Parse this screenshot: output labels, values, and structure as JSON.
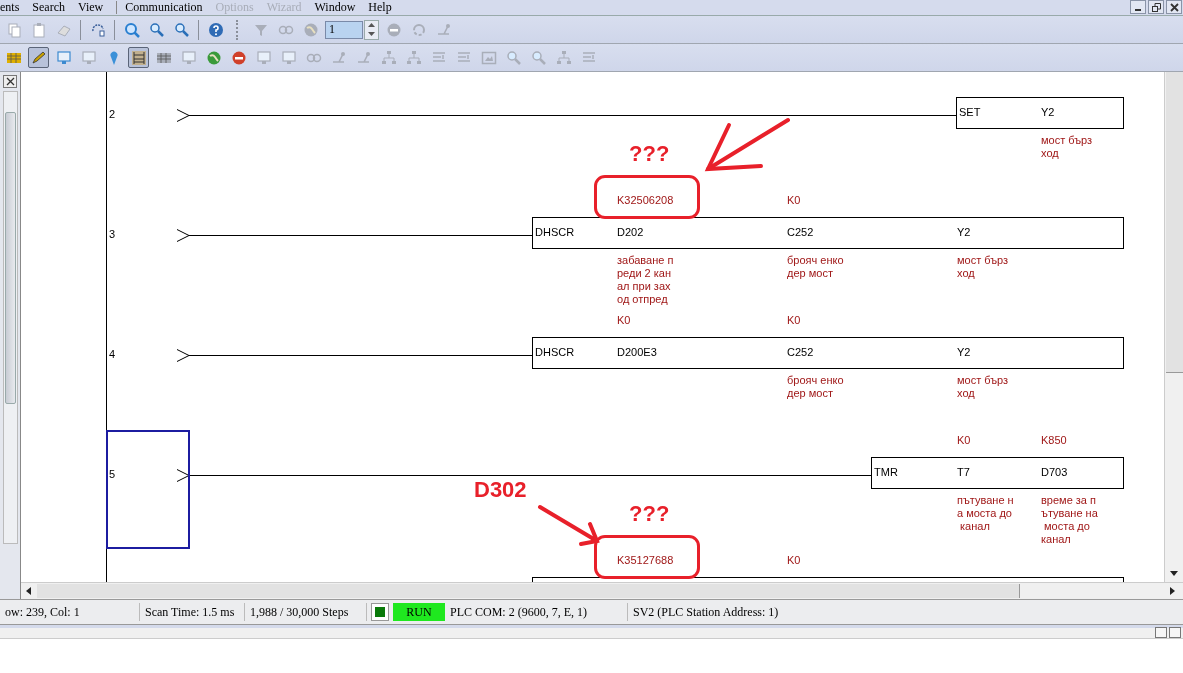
{
  "menu": [
    {
      "label": "ents",
      "disabled": false
    },
    {
      "label": "Search",
      "disabled": false
    },
    {
      "label": "View",
      "disabled": false
    },
    {
      "label": "Communication",
      "disabled": false
    },
    {
      "label": "Options",
      "disabled": true
    },
    {
      "label": "Wizard",
      "disabled": true
    },
    {
      "label": "Window",
      "disabled": false
    },
    {
      "label": "Help",
      "disabled": false
    }
  ],
  "toolbar_1": [
    {
      "kind": "document",
      "disabled": true
    },
    {
      "kind": "clipboard",
      "disabled": true
    },
    {
      "kind": "eraser",
      "disabled": true
    },
    {
      "kind": "separator"
    },
    {
      "kind": "curved-arrow",
      "disabled": false
    },
    {
      "kind": "separator"
    },
    {
      "kind": "search",
      "disabled": false
    },
    {
      "kind": "zoom-in",
      "disabled": false
    },
    {
      "kind": "zoom-out",
      "disabled": false
    },
    {
      "kind": "separator"
    },
    {
      "kind": "help",
      "disabled": false
    },
    {
      "kind": "grip"
    },
    {
      "kind": "funnel",
      "disabled": true
    },
    {
      "kind": "link",
      "disabled": true
    },
    {
      "kind": "globe",
      "disabled": true
    },
    {
      "kind": "spinner",
      "value": "1"
    },
    {
      "kind": "stop",
      "disabled": true
    },
    {
      "kind": "refresh",
      "disabled": true
    },
    {
      "kind": "branch",
      "disabled": true
    }
  ],
  "toolbar_2": [
    {
      "kind": "grid",
      "disabled": false,
      "pressed": false
    },
    {
      "kind": "pencil",
      "disabled": false,
      "pressed": true
    },
    {
      "kind": "monitor",
      "disabled": false,
      "pressed": false
    },
    {
      "kind": "monitor",
      "disabled": true,
      "pressed": false
    },
    {
      "kind": "pin",
      "disabled": false,
      "pressed": false
    },
    {
      "kind": "ladder",
      "disabled": false,
      "pressed": true
    },
    {
      "kind": "grid",
      "disabled": true,
      "pressed": false
    },
    {
      "kind": "monitor",
      "disabled": true,
      "pressed": false
    },
    {
      "kind": "globe",
      "disabled": false,
      "pressed": false
    },
    {
      "kind": "stop",
      "disabled": false,
      "pressed": false
    },
    {
      "kind": "monitor",
      "disabled": true,
      "pressed": false
    },
    {
      "kind": "monitor",
      "disabled": true,
      "pressed": false
    },
    {
      "kind": "link",
      "disabled": true,
      "pressed": false
    },
    {
      "kind": "branch",
      "disabled": true,
      "pressed": false
    },
    {
      "kind": "branch",
      "disabled": true,
      "pressed": false
    },
    {
      "kind": "network",
      "disabled": true,
      "pressed": false
    },
    {
      "kind": "network",
      "disabled": true,
      "pressed": false
    },
    {
      "kind": "lines",
      "disabled": true,
      "pressed": false
    },
    {
      "kind": "lines",
      "disabled": true,
      "pressed": false
    },
    {
      "kind": "frame",
      "disabled": true,
      "pressed": false
    },
    {
      "kind": "zoom-in",
      "disabled": true,
      "pressed": false
    },
    {
      "kind": "zoom-in",
      "disabled": true,
      "pressed": false
    },
    {
      "kind": "network",
      "disabled": true,
      "pressed": false
    },
    {
      "kind": "lines",
      "disabled": true,
      "pressed": false
    }
  ],
  "ladder": {
    "rungs": [
      {
        "number": "2",
        "selected": false,
        "kind": "narrow",
        "instruction": "SET",
        "operands": [
          {
            "name": "Y2",
            "comment": [
              "мост бърз",
              "ход"
            ]
          }
        ]
      },
      {
        "number": "3",
        "selected": false,
        "kind": "wide",
        "instruction": "DHSCR",
        "operands": [
          {
            "name": "D202",
            "above": "K32506208",
            "circled": true,
            "note": "???",
            "comment": [
              "забаване п",
              "реди 2 кан",
              "ал при зах",
              "од отпред"
            ]
          },
          {
            "name": "C252",
            "above": "K0",
            "comment": [
              "брояч енко",
              "дер мост"
            ]
          },
          {
            "name": "Y2",
            "comment": [
              "мост бърз",
              "ход"
            ]
          }
        ]
      },
      {
        "number": "4",
        "selected": false,
        "kind": "wide",
        "instruction": "DHSCR",
        "operands": [
          {
            "name": "D200E3",
            "above": "K0"
          },
          {
            "name": "C252",
            "above": "K0",
            "comment": [
              "брояч енко",
              "дер мост"
            ]
          },
          {
            "name": "Y2",
            "comment": [
              "мост бърз",
              "ход"
            ]
          }
        ]
      },
      {
        "number": "5",
        "selected": true,
        "kind": "medium",
        "instruction": "TMR",
        "operands": [
          {
            "name": "T7",
            "above": "K0",
            "comment": [
              "пътуване н",
              "а моста до",
              " канал"
            ]
          },
          {
            "name": "D703",
            "above": "K850",
            "comment": [
              "време за п",
              "ътуване на",
              " моста до",
              "канал"
            ]
          }
        ]
      },
      {
        "selected": false,
        "kind": "wide",
        "operands": [
          {
            "above": "K35127688",
            "circled": true,
            "note": "???",
            "callout": "D302"
          },
          {
            "above": "K0"
          }
        ]
      }
    ]
  },
  "status_bar": {
    "position": "ow: 239, Col: 1",
    "scan_time": "Scan Time: 1.5 ms",
    "steps": "1,988 / 30,000 Steps",
    "run_state": {
      "label": "RUN",
      "on": true
    },
    "com": "PLC COM: 2 (9600, 7, E, 1)",
    "station": "SV2 (PLC Station Address: 1)"
  }
}
